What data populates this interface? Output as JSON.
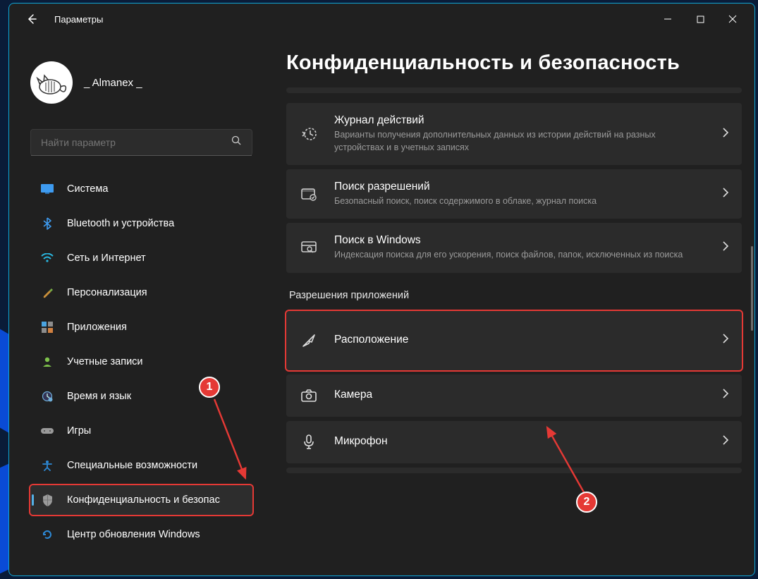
{
  "window": {
    "title": "Параметры"
  },
  "user": {
    "name": "_ Almanex _"
  },
  "search": {
    "placeholder": "Найти параметр"
  },
  "sidebar": {
    "items": [
      {
        "label": "Система",
        "icon": "system-icon",
        "color": "#3e9bf0"
      },
      {
        "label": "Bluetooth и устройства",
        "icon": "bluetooth-icon",
        "color": "#3e9bf0"
      },
      {
        "label": "Сеть и Интернет",
        "icon": "wifi-icon",
        "color": "#2ab7e0"
      },
      {
        "label": "Персонализация",
        "icon": "brush-icon",
        "color": "#c98f3a"
      },
      {
        "label": "Приложения",
        "icon": "apps-icon",
        "color": "#8d8d8d"
      },
      {
        "label": "Учетные записи",
        "icon": "person-icon",
        "color": "#7ec24b"
      },
      {
        "label": "Время и язык",
        "icon": "clock-icon",
        "color": "#6faed9"
      },
      {
        "label": "Игры",
        "icon": "gamepad-icon",
        "color": "#9a9a9a"
      },
      {
        "label": "Специальные возможности",
        "icon": "accessibility-icon",
        "color": "#2d89d6"
      },
      {
        "label": "Конфиденциальность и безопас",
        "icon": "shield-icon",
        "color": "#9a9a9a",
        "active": true,
        "highlighted": true
      },
      {
        "label": "Центр обновления Windows",
        "icon": "update-icon",
        "color": "#2d89d6"
      }
    ]
  },
  "main": {
    "title": "Конфиденциальность и безопасность",
    "cards_top": [
      {
        "title": "Журнал действий",
        "sub": "Варианты получения дополнительных данных из истории действий на разных устройствах и в учетных записях",
        "icon": "activity-icon"
      },
      {
        "title": "Поиск разрешений",
        "sub": "Безопасный поиск, поиск содержимого в облаке, журнал поиска",
        "icon": "search-perm-icon"
      },
      {
        "title": "Поиск в Windows",
        "sub": "Индексация поиска для его ускорения, поиск файлов, папок, исключенных из поиска",
        "icon": "search-win-icon"
      }
    ],
    "section_header": "Разрешения приложений",
    "cards_bottom": [
      {
        "title": "Расположение",
        "icon": "location-icon",
        "highlighted": true
      },
      {
        "title": "Камера",
        "icon": "camera-icon"
      },
      {
        "title": "Микрофон",
        "icon": "microphone-icon"
      }
    ]
  },
  "annotations": {
    "badge1": "1",
    "badge2": "2"
  }
}
